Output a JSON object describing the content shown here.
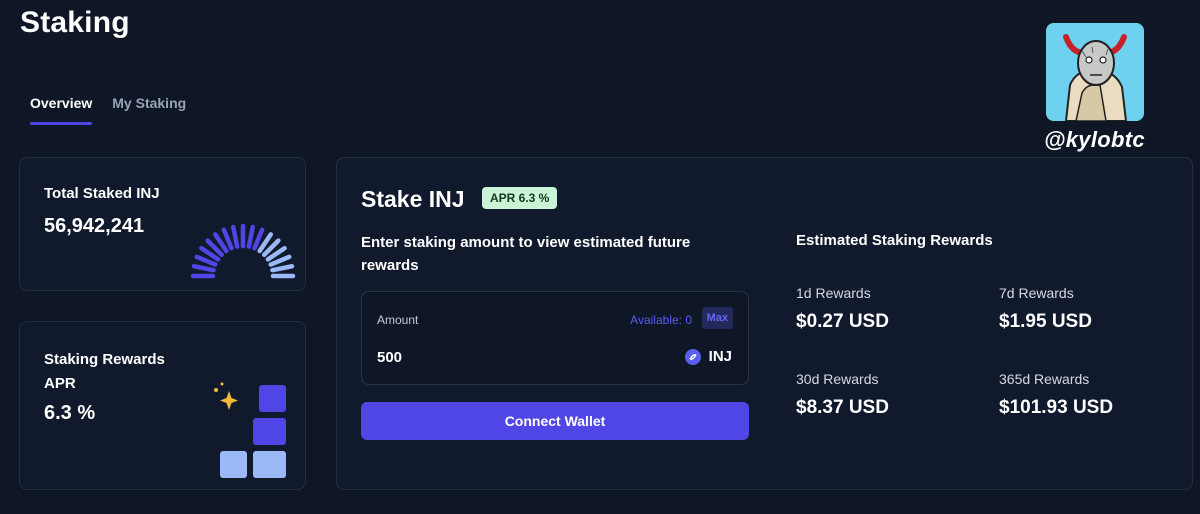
{
  "page": {
    "title": "Staking"
  },
  "tabs": [
    {
      "label": "Overview",
      "active": true
    },
    {
      "label": "My Staking",
      "active": false
    }
  ],
  "total_staked": {
    "label": "Total Staked INJ",
    "value": "56,942,241"
  },
  "staking_rewards": {
    "label_line1": "Staking Rewards",
    "label_line2": "APR",
    "value": "6.3 %"
  },
  "stake": {
    "title": "Stake INJ",
    "apr_badge": "APR 6.3 %",
    "instruction": "Enter staking amount to view estimated future rewards",
    "amount_label": "Amount",
    "available": "Available: 0",
    "max_label": "Max",
    "amount_value": "500",
    "token": "INJ",
    "connect_label": "Connect Wallet"
  },
  "estimated": {
    "title": "Estimated Staking Rewards",
    "items": [
      {
        "period": "1d Rewards",
        "amount": "$0.27 USD"
      },
      {
        "period": "7d Rewards",
        "amount": "$1.95 USD"
      },
      {
        "period": "30d Rewards",
        "amount": "$8.37 USD"
      },
      {
        "period": "365d Rewards",
        "amount": "$101.93 USD"
      }
    ]
  },
  "profile": {
    "handle": "@kylobtc"
  },
  "colors": {
    "accent": "#4f46e5",
    "background": "#0f1626",
    "card": "#111a2c",
    "badge": "#c9f5d6"
  }
}
